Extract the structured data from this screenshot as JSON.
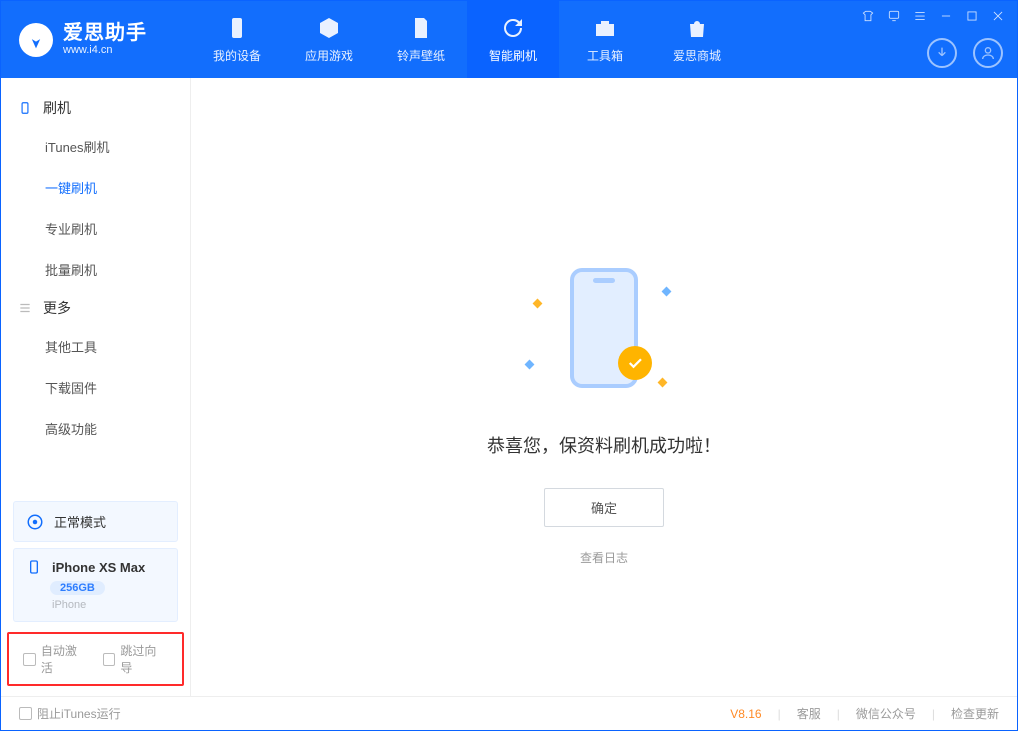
{
  "header": {
    "brand": "爱思助手",
    "domain": "www.i4.cn",
    "tabs": [
      {
        "label": "我的设备"
      },
      {
        "label": "应用游戏"
      },
      {
        "label": "铃声壁纸"
      },
      {
        "label": "智能刷机"
      },
      {
        "label": "工具箱"
      },
      {
        "label": "爱思商城"
      }
    ]
  },
  "sidebar": {
    "group1": {
      "title": "刷机",
      "items": [
        "iTunes刷机",
        "一键刷机",
        "专业刷机",
        "批量刷机"
      ]
    },
    "group2": {
      "title": "更多",
      "items": [
        "其他工具",
        "下载固件",
        "高级功能"
      ]
    },
    "mode": "正常模式",
    "device": {
      "name": "iPhone XS Max",
      "capacity": "256GB",
      "model": "iPhone"
    },
    "options": {
      "auto_activate": "自动激活",
      "skip_guide": "跳过向导"
    }
  },
  "main": {
    "success_text": "恭喜您，保资料刷机成功啦！",
    "ok_button": "确定",
    "view_log": "查看日志"
  },
  "footer": {
    "block_itunes": "阻止iTunes运行",
    "version": "V8.16",
    "links": [
      "客服",
      "微信公众号",
      "检查更新"
    ]
  }
}
